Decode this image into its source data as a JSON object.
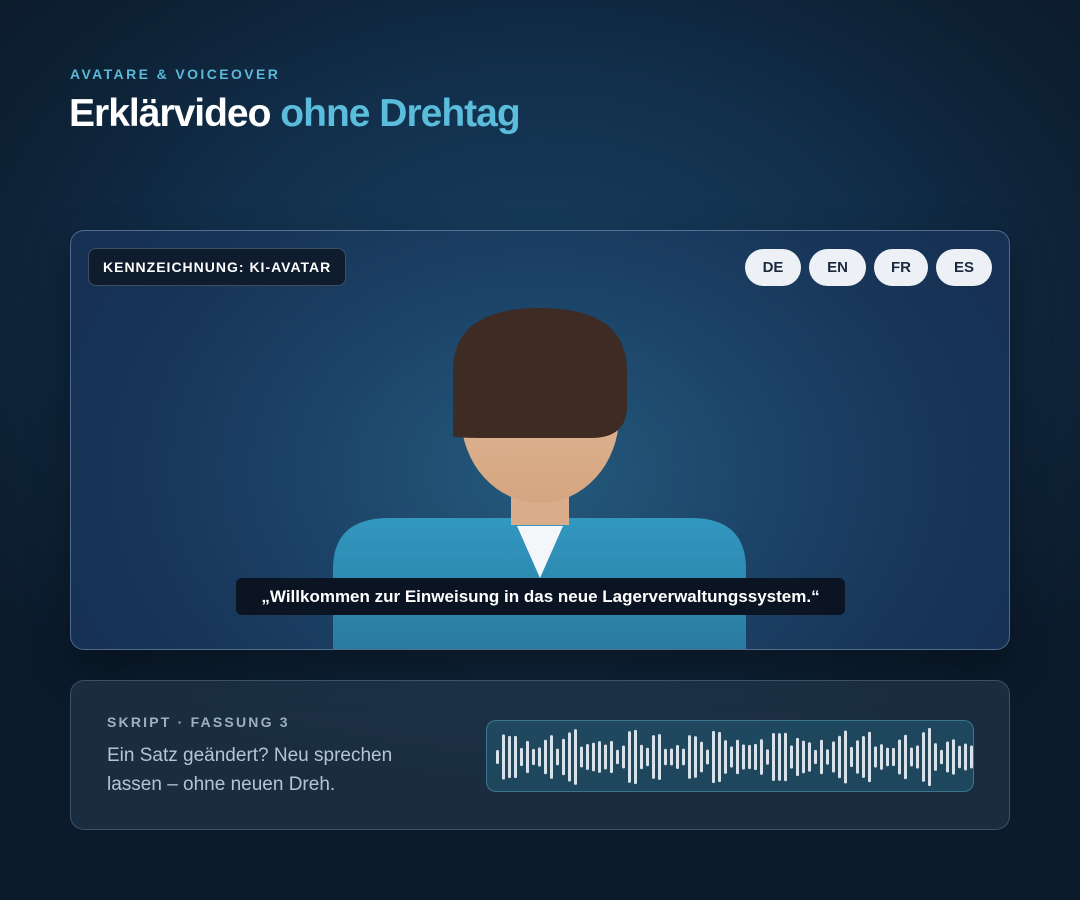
{
  "header": {
    "eyebrow": "AVATARE & VOICEOVER",
    "title_main": "Erklärvideo",
    "title_accent": "ohne Drehtag"
  },
  "video": {
    "badge": "KENNZEICHNUNG: KI-AVATAR",
    "languages": [
      "DE",
      "EN",
      "FR",
      "ES"
    ],
    "subtitle": "„Willkommen zur Einweisung in das neue Lagerverwaltungssystem.“"
  },
  "script": {
    "label": "SKRIPT · FASSUNG 3",
    "text": "Ein Satz geändert? Neu sprechen lassen – ohne neuen Dreh."
  },
  "colors": {
    "accent": "#5bbcdc",
    "shirt": "#2f8fb8",
    "hair": "#3d2b24",
    "skin": "#deb08c"
  },
  "icons": {
    "waveform": "audio-waveform-icon"
  }
}
